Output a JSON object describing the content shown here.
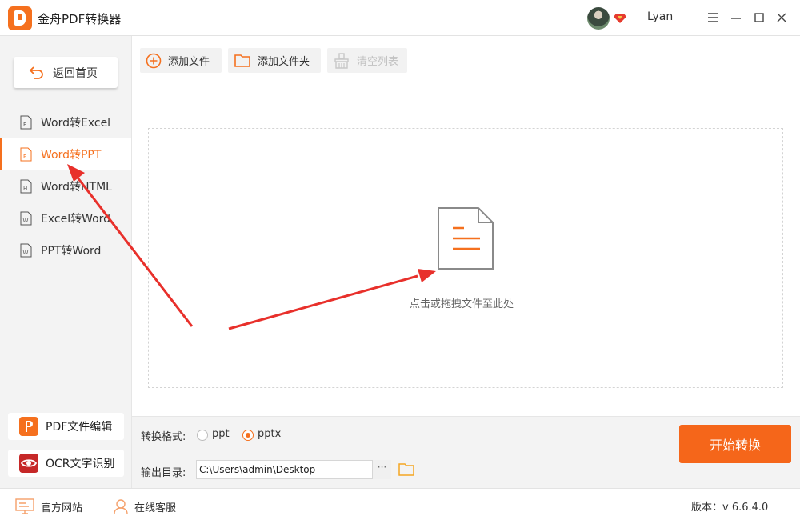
{
  "app": {
    "title": "金舟PDF转换器",
    "username": "Lyan"
  },
  "sidebar": {
    "back_label": "返回首页",
    "items": [
      {
        "label": "Word转Excel",
        "badge": "E",
        "active": false
      },
      {
        "label": "Word转PPT",
        "badge": "P",
        "active": true
      },
      {
        "label": "Word转HTML",
        "badge": "H",
        "active": false
      },
      {
        "label": "Excel转Word",
        "badge": "W",
        "active": false
      },
      {
        "label": "PPT转Word",
        "badge": "W",
        "active": false
      }
    ],
    "tools": [
      {
        "label": "PDF文件编辑",
        "icon": "pdf-edit-icon"
      },
      {
        "label": "OCR文字识别",
        "icon": "ocr-eye-icon"
      }
    ]
  },
  "toolbar": {
    "add_file": "添加文件",
    "add_folder": "添加文件夹",
    "clear_list": "清空列表"
  },
  "dropzone": {
    "hint": "点击或拖拽文件至此处"
  },
  "settings": {
    "format_label": "转换格式:",
    "formats": [
      {
        "label": "ppt",
        "checked": false
      },
      {
        "label": "pptx",
        "checked": true
      }
    ],
    "output_label": "输出目录:",
    "output_path": "C:\\Users\\admin\\Desktop",
    "more": "···",
    "start_label": "开始转换"
  },
  "statusbar": {
    "website": "官方网站",
    "support": "在线客服",
    "version_label": "版本：",
    "version": "v 6.6.4.0"
  },
  "colors": {
    "accent": "#f5701e",
    "start_button": "#f5661a",
    "annotation_arrow": "#e8302b"
  }
}
